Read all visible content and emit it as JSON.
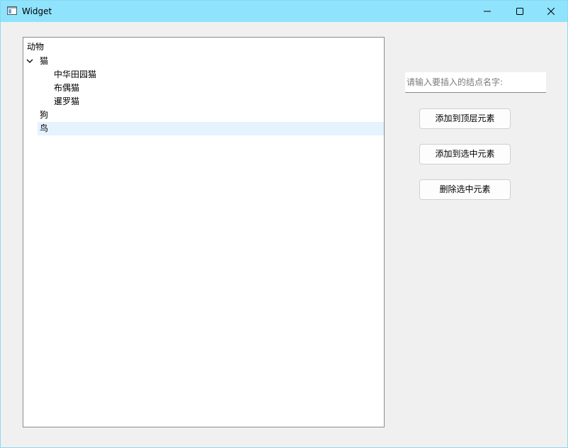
{
  "window": {
    "title": "Widget",
    "titlebar_color": "#8fe3fd",
    "controls": [
      "minimize-icon",
      "maximize-icon",
      "close-icon"
    ]
  },
  "tree": {
    "header": "动物",
    "items": [
      {
        "label": "猫",
        "level": 0,
        "expanded": true,
        "selected": false
      },
      {
        "label": "中华田园猫",
        "level": 1,
        "selected": false
      },
      {
        "label": "布偶猫",
        "level": 1,
        "selected": false
      },
      {
        "label": "暹罗猫",
        "level": 1,
        "selected": false
      },
      {
        "label": "狗",
        "level": 0,
        "selected": false
      },
      {
        "label": "鸟",
        "level": 0,
        "selected": true
      }
    ],
    "selection_color": "#e5f3ff"
  },
  "input": {
    "value": "",
    "placeholder": "请输入要插入的结点名字:"
  },
  "buttons": {
    "add_top": "添加到顶层元素",
    "add_selected": "添加到选中元素",
    "delete_selected": "删除选中元素"
  }
}
